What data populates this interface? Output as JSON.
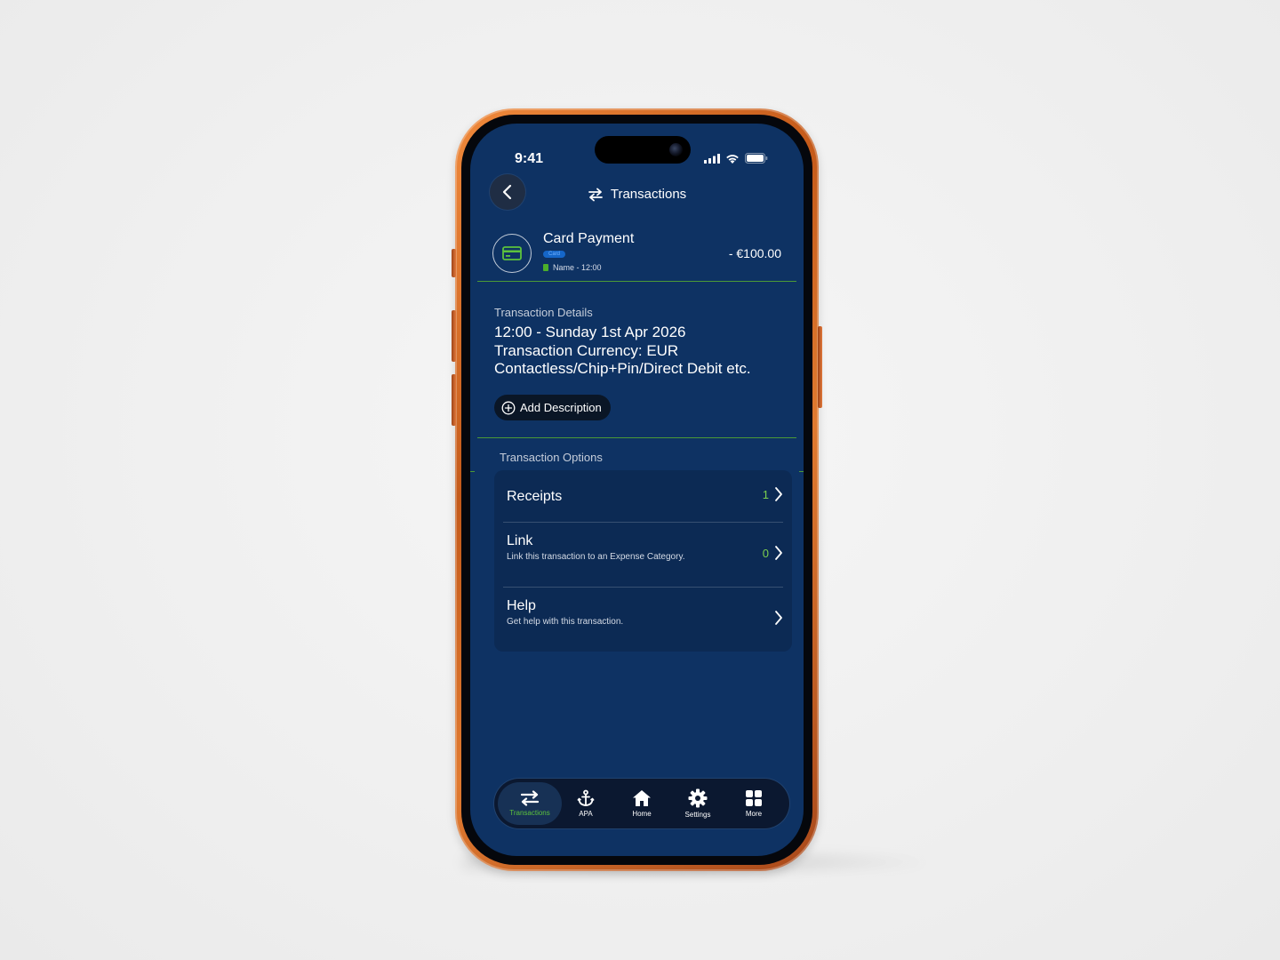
{
  "status_bar": {
    "time": "9:41"
  },
  "header": {
    "title": "Transactions",
    "icon": "swap-arrows-icon"
  },
  "transaction": {
    "title": "Card Payment",
    "badge": "Card",
    "meta": "Name - 12:00",
    "amount": "- €100.00",
    "icon": "credit-card-icon",
    "accent_color": "#4caf2b"
  },
  "details": {
    "label": "Transaction Details",
    "lines": [
      "12:00 - Sunday 1st Apr 2026",
      "Transaction Currency: EUR",
      "Contactless/Chip+Pin/Direct Debit etc."
    ],
    "add_description_label": "Add Description"
  },
  "options": {
    "label": "Transaction Options",
    "items": [
      {
        "title": "Receipts",
        "subtitle": "",
        "count": "1"
      },
      {
        "title": "Link",
        "subtitle": "Link this transaction to an Expense Category.",
        "count": "0"
      },
      {
        "title": "Help",
        "subtitle": "Get help with this transaction.",
        "count": ""
      }
    ]
  },
  "nav": {
    "items": [
      {
        "label": "Transactions",
        "icon": "swap-arrows-icon",
        "active": true
      },
      {
        "label": "APA",
        "icon": "anchor-icon",
        "active": false
      },
      {
        "label": "Home",
        "icon": "home-icon",
        "active": false
      },
      {
        "label": "Settings",
        "icon": "gear-icon",
        "active": false
      },
      {
        "label": "More",
        "icon": "grid-icon",
        "active": false
      }
    ]
  },
  "colors": {
    "screen_bg": "#0e3263",
    "accent_green": "#5cc23d",
    "phone_frame": "#e07a30"
  }
}
